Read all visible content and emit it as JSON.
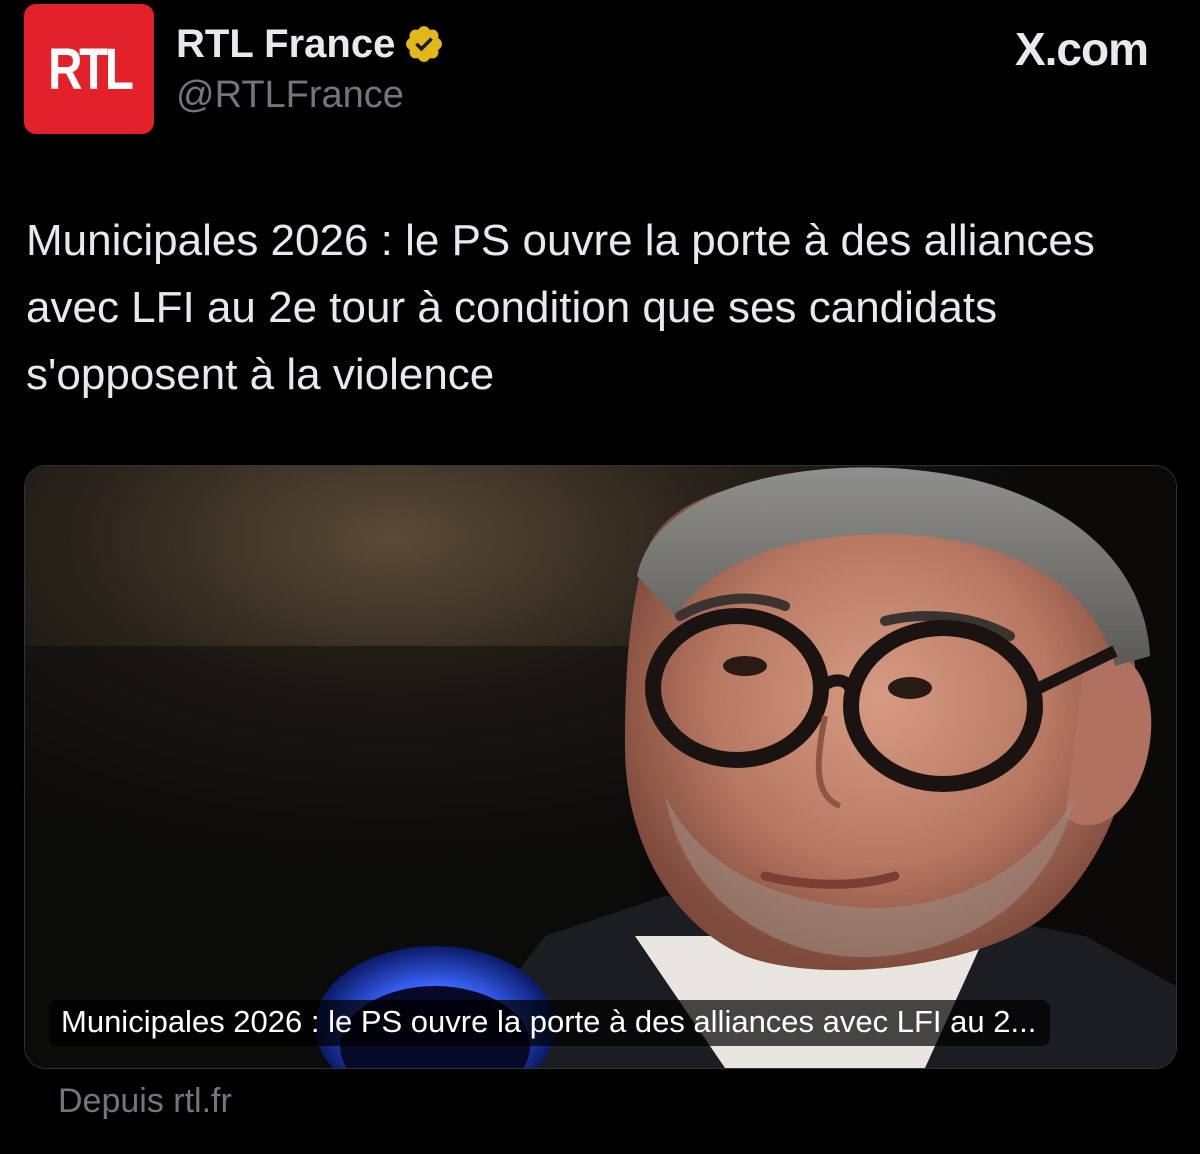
{
  "account": {
    "avatar_text": "RTL",
    "display_name": "RTL France",
    "handle": "@RTLFrance",
    "verified_icon": "verified-badge-gold-icon",
    "avatar_color": "#e2212b",
    "verified_color": "#e2b719"
  },
  "site": {
    "label": "X.com"
  },
  "tweet": {
    "text": "Municipales 2026 : le PS ouvre la porte à des alliances avec LFI au 2e tour à condition que ses candidats s'opposent à la violence"
  },
  "link_card": {
    "caption": "Municipales 2026 : le PS ouvre la porte à des alliances avec LFI au 2...",
    "image_description_icon": "news-photo-icon",
    "source": "Depuis rtl.fr"
  }
}
